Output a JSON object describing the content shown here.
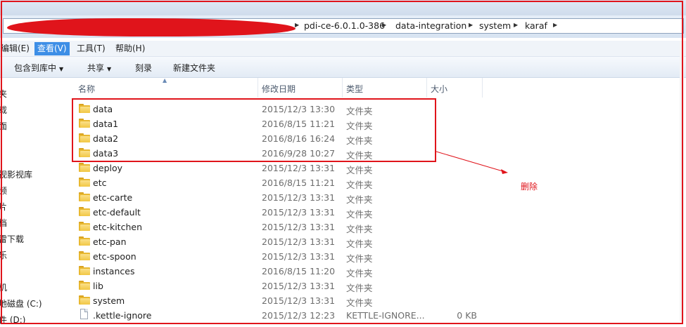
{
  "address": {
    "crumbs": [
      "pdi-ce-6.0.1.0-386",
      "data-integration",
      "system",
      "karaf"
    ]
  },
  "menu": {
    "items": [
      {
        "label": "编辑(E)",
        "active": false
      },
      {
        "label": "查看(V)",
        "active": true
      },
      {
        "label": "工具(T)",
        "active": false
      },
      {
        "label": "帮助(H)",
        "active": false
      }
    ]
  },
  "toolbar": {
    "include_label": "包含到库中",
    "share_label": "共享",
    "burn_label": "刻录",
    "newfolder_label": "新建文件夹"
  },
  "sidebar": {
    "items": [
      "夹",
      "载",
      "面",
      "视影视库",
      "频",
      "片",
      "档",
      "雷下载",
      "乐",
      "机",
      "地磁盘 (C:)",
      "件 (D:)"
    ]
  },
  "columns": {
    "name": "名称",
    "date": "修改日期",
    "type": "类型",
    "size": "大小"
  },
  "files": [
    {
      "name": "data",
      "date": "2015/12/3 13:30",
      "type": "文件夹",
      "size": "",
      "icon": "folder-icon"
    },
    {
      "name": "data1",
      "date": "2016/8/15 11:21",
      "type": "文件夹",
      "size": "",
      "icon": "folder-icon"
    },
    {
      "name": "data2",
      "date": "2016/8/16 16:24",
      "type": "文件夹",
      "size": "",
      "icon": "folder-icon"
    },
    {
      "name": "data3",
      "date": "2016/9/28 10:27",
      "type": "文件夹",
      "size": "",
      "icon": "folder-icon"
    },
    {
      "name": "deploy",
      "date": "2015/12/3 13:31",
      "type": "文件夹",
      "size": "",
      "icon": "folder-icon"
    },
    {
      "name": "etc",
      "date": "2016/8/15 11:21",
      "type": "文件夹",
      "size": "",
      "icon": "folder-icon"
    },
    {
      "name": "etc-carte",
      "date": "2015/12/3 13:31",
      "type": "文件夹",
      "size": "",
      "icon": "folder-icon"
    },
    {
      "name": "etc-default",
      "date": "2015/12/3 13:31",
      "type": "文件夹",
      "size": "",
      "icon": "folder-icon"
    },
    {
      "name": "etc-kitchen",
      "date": "2015/12/3 13:31",
      "type": "文件夹",
      "size": "",
      "icon": "folder-icon"
    },
    {
      "name": "etc-pan",
      "date": "2015/12/3 13:31",
      "type": "文件夹",
      "size": "",
      "icon": "folder-icon"
    },
    {
      "name": "etc-spoon",
      "date": "2015/12/3 13:31",
      "type": "文件夹",
      "size": "",
      "icon": "folder-icon"
    },
    {
      "name": "instances",
      "date": "2016/8/15 11:20",
      "type": "文件夹",
      "size": "",
      "icon": "folder-icon"
    },
    {
      "name": "lib",
      "date": "2015/12/3 13:31",
      "type": "文件夹",
      "size": "",
      "icon": "folder-icon"
    },
    {
      "name": "system",
      "date": "2015/12/3 13:31",
      "type": "文件夹",
      "size": "",
      "icon": "folder-icon"
    },
    {
      "name": ".kettle-ignore",
      "date": "2015/12/3 12:23",
      "type": "KETTLE-IGNORE...",
      "size": "0 KB",
      "icon": "file-icon"
    }
  ],
  "annotation": {
    "text": "删除",
    "color": "#e0141b"
  },
  "colors": {
    "menu_active": "#3d8ee6",
    "annotation_red": "#e0141b",
    "folder": "#f2c744"
  }
}
